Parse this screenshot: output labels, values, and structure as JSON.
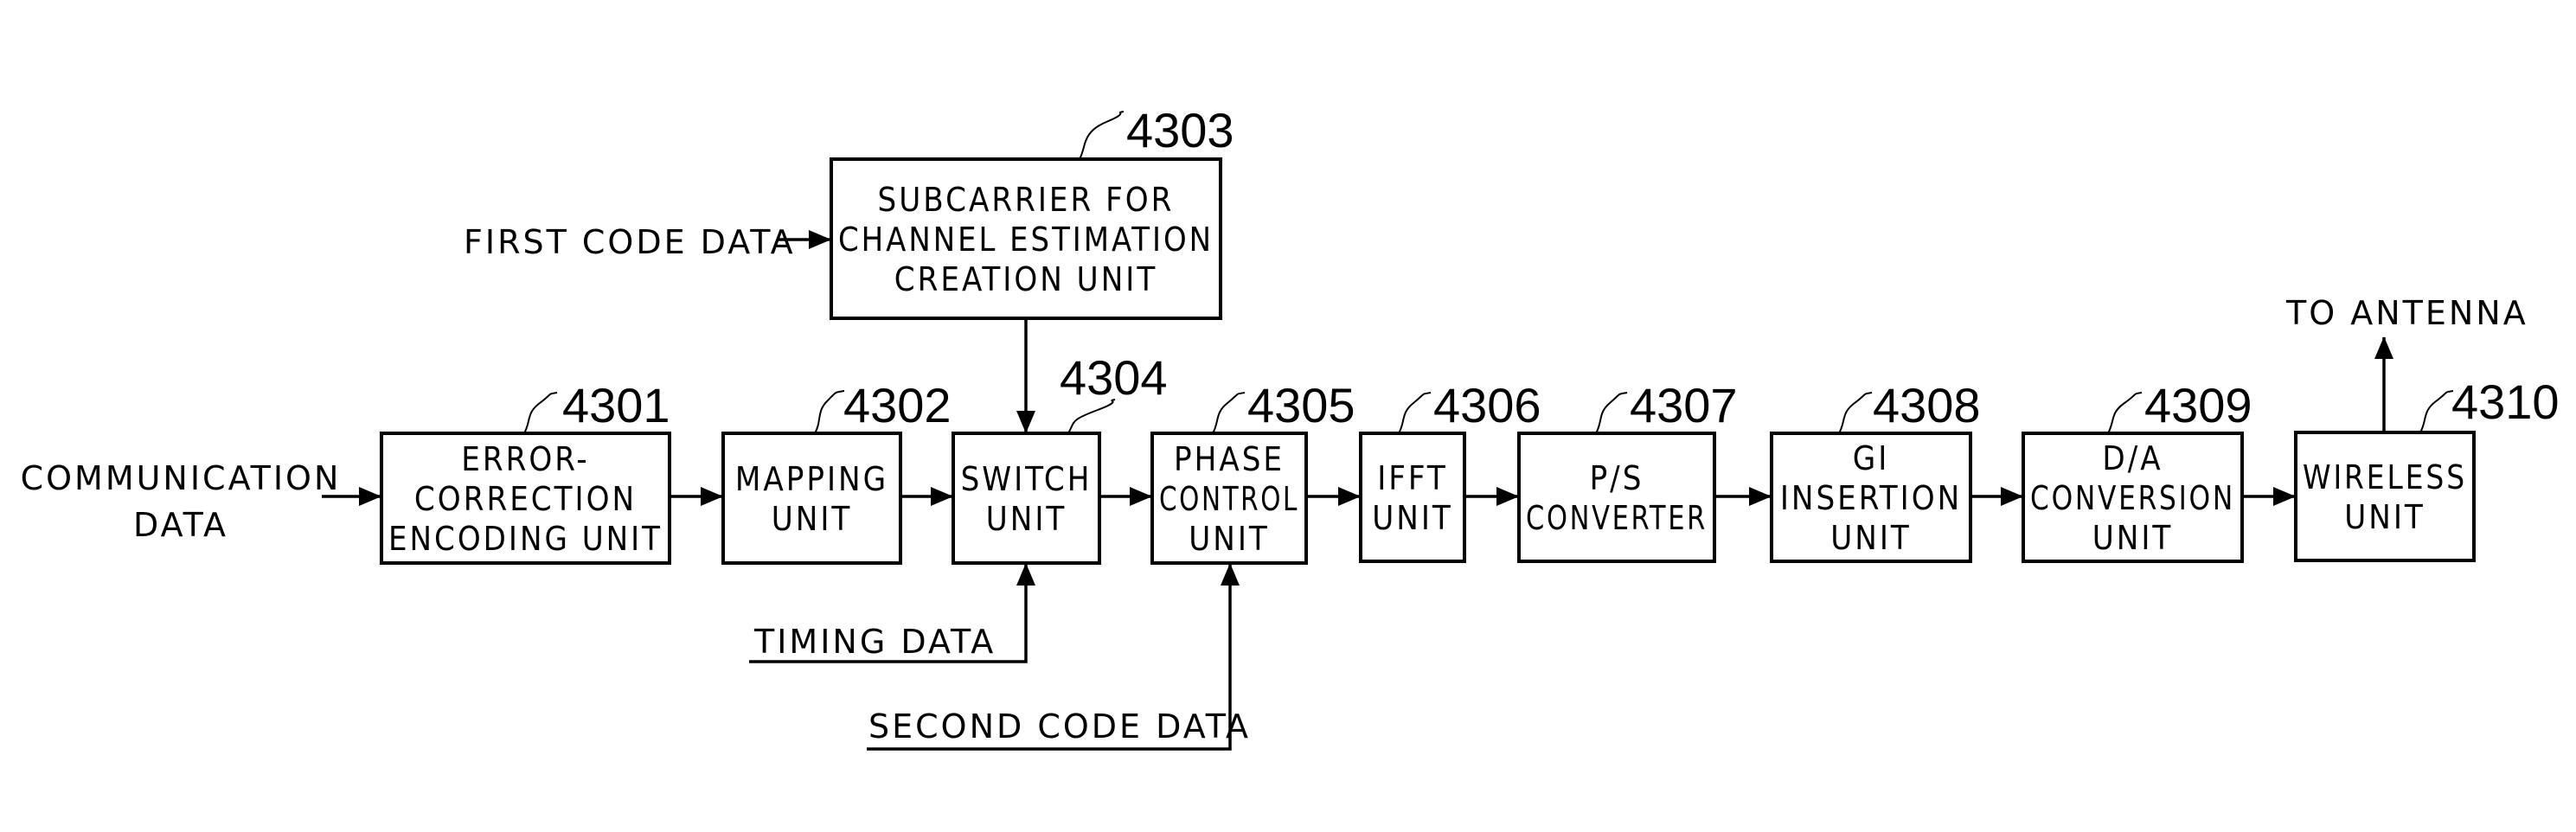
{
  "figure": {
    "blocks": [
      {
        "id": "4301",
        "ref": "4301",
        "lines": [
          "ERROR-",
          "CORRECTION",
          "ENCODING UNIT"
        ]
      },
      {
        "id": "4302",
        "ref": "4302",
        "lines": [
          "MAPPING",
          "UNIT"
        ]
      },
      {
        "id": "4303",
        "ref": "4303",
        "lines": [
          "SUBCARRIER FOR",
          "CHANNEL ESTIMATION",
          "CREATION UNIT"
        ]
      },
      {
        "id": "4304",
        "ref": "4304",
        "lines": [
          "SWITCH",
          "UNIT"
        ]
      },
      {
        "id": "4305",
        "ref": "4305",
        "lines": [
          "PHASE",
          "CONTROL",
          "UNIT"
        ]
      },
      {
        "id": "4306",
        "ref": "4306",
        "lines": [
          "IFFT",
          "UNIT"
        ]
      },
      {
        "id": "4307",
        "ref": "4307",
        "lines": [
          "P/S",
          "CONVERTER"
        ]
      },
      {
        "id": "4308",
        "ref": "4308",
        "lines": [
          "GI",
          "INSERTION",
          "UNIT"
        ]
      },
      {
        "id": "4309",
        "ref": "4309",
        "lines": [
          "D/A",
          "CONVERSION",
          "UNIT"
        ]
      },
      {
        "id": "4310",
        "ref": "4310",
        "lines": [
          "WIRELESS",
          "UNIT"
        ]
      }
    ],
    "signals": {
      "communication_data": [
        "COMMUNICATION",
        "DATA"
      ],
      "first_code_data": "FIRST CODE DATA",
      "timing_data": "TIMING DATA",
      "second_code_data": "SECOND CODE DATA",
      "to_antenna": "TO ANTENNA"
    },
    "connections": [
      {
        "from": "COMMUNICATION DATA",
        "to": "4301"
      },
      {
        "from": "4301",
        "to": "4302"
      },
      {
        "from": "4302",
        "to": "4304"
      },
      {
        "from": "FIRST CODE DATA",
        "to": "4303"
      },
      {
        "from": "4303",
        "to": "4304"
      },
      {
        "from": "TIMING DATA",
        "to": "4304"
      },
      {
        "from": "4304",
        "to": "4305"
      },
      {
        "from": "SECOND CODE DATA",
        "to": "4305"
      },
      {
        "from": "4305",
        "to": "4306"
      },
      {
        "from": "4306",
        "to": "4307"
      },
      {
        "from": "4307",
        "to": "4308"
      },
      {
        "from": "4308",
        "to": "4309"
      },
      {
        "from": "4309",
        "to": "4310"
      },
      {
        "from": "4310",
        "to": "TO ANTENNA"
      }
    ]
  }
}
